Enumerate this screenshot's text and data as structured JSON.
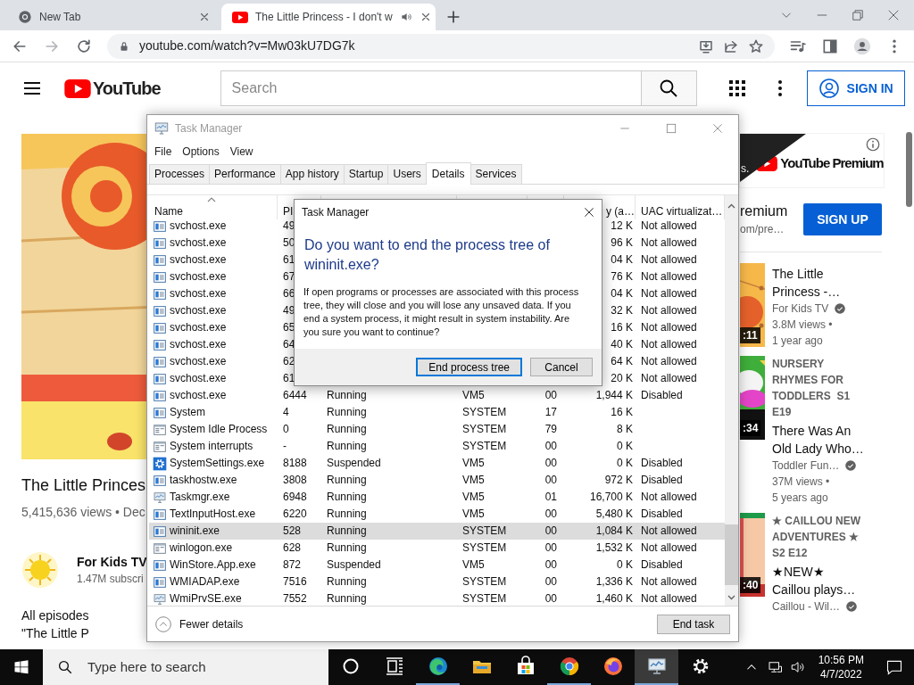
{
  "browser": {
    "tabs": [
      {
        "title": "New Tab",
        "kind": "chrome",
        "selected": false,
        "audio": false
      },
      {
        "title": "The Little Princess - I don't w",
        "kind": "youtube",
        "selected": true,
        "audio": true
      }
    ],
    "url": "youtube.com/watch?v=Mw03kU7DG7k"
  },
  "youtube": {
    "logo": "YouTube",
    "search_placeholder": "Search",
    "sign_in": "SIGN IN",
    "video": {
      "title": "The Little Princes",
      "stats": "5,415,636 views • Dec",
      "channel": "For Kids TV",
      "subscribers": "1.47M subscri",
      "description": [
        "All episodes",
        "\"The Little P"
      ]
    },
    "ad": {
      "fragment": "s.",
      "logo": "YouTube Premium",
      "line_1": "remium",
      "line_2": "om/pre…",
      "button": "SIGN UP"
    },
    "related": [
      {
        "kind": "orange",
        "title": "The Little Princess -…",
        "channel": "For Kids TV",
        "views": "3.8M views •",
        "age": "1 year ago",
        "duration": ":11"
      },
      {
        "kind": "green",
        "series": "NURSERY RHYMES FOR TODDLERS  S1 E19",
        "title": "There Was An Old Lady Who…",
        "channel": "Toddler Fun…",
        "views": "37M views •",
        "age": "5 years ago",
        "duration": ":34"
      },
      {
        "kind": "peach",
        "series": "★ CAILLOU NEW ADVENTURES ★  S2 E12",
        "title": "★NEW★ Caillou plays…",
        "channel": "Caillou - Wil…",
        "duration": ":40"
      }
    ]
  },
  "task_manager": {
    "title": "Task Manager",
    "menu": [
      "File",
      "Options",
      "View"
    ],
    "tabs": [
      {
        "label": "Processes",
        "selected": false
      },
      {
        "label": "Performance",
        "selected": false
      },
      {
        "label": "App history",
        "selected": false
      },
      {
        "label": "Startup",
        "selected": false
      },
      {
        "label": "Users",
        "selected": false
      },
      {
        "label": "Details",
        "selected": true
      },
      {
        "label": "Services",
        "selected": false
      }
    ],
    "columns": {
      "name": "Name",
      "pid": "PI",
      "memory": "y (a…",
      "uac": "UAC virtualizat…"
    },
    "rows": [
      {
        "kind": "window",
        "name": "svchost.exe",
        "pid": "49",
        "memory": "12 K",
        "uac": "Not allowed",
        "selected": false
      },
      {
        "kind": "window",
        "name": "svchost.exe",
        "pid": "50",
        "memory": "96 K",
        "uac": "Not allowed",
        "selected": false
      },
      {
        "kind": "window",
        "name": "svchost.exe",
        "pid": "61",
        "memory": "04 K",
        "uac": "Not allowed",
        "selected": false
      },
      {
        "kind": "window",
        "name": "svchost.exe",
        "pid": "67",
        "memory": "76 K",
        "uac": "Not allowed",
        "selected": false
      },
      {
        "kind": "window",
        "name": "svchost.exe",
        "pid": "66",
        "memory": "04 K",
        "uac": "Not allowed",
        "selected": false
      },
      {
        "kind": "window",
        "name": "svchost.exe",
        "pid": "49",
        "memory": "32 K",
        "uac": "Not allowed",
        "selected": false
      },
      {
        "kind": "window",
        "name": "svchost.exe",
        "pid": "65",
        "memory": "16 K",
        "uac": "Not allowed",
        "selected": false
      },
      {
        "kind": "window",
        "name": "svchost.exe",
        "pid": "64",
        "memory": "40 K",
        "uac": "Not allowed",
        "selected": false
      },
      {
        "kind": "window",
        "name": "svchost.exe",
        "pid": "62",
        "memory": "64 K",
        "uac": "Not allowed",
        "selected": false
      },
      {
        "kind": "window",
        "name": "svchost.exe",
        "pid": "61",
        "memory": "20 K",
        "uac": "Not allowed",
        "selected": false
      },
      {
        "kind": "window",
        "name": "svchost.exe",
        "pid": "6444",
        "status": "Running",
        "user": "VM5",
        "cpu": "00",
        "memory": "1,944 K",
        "uac": "Disabled",
        "selected": false
      },
      {
        "kind": "window",
        "name": "System",
        "pid": "4",
        "status": "Running",
        "user": "SYSTEM",
        "cpu": "17",
        "memory": "16 K",
        "selected": false
      },
      {
        "kind": "system",
        "name": "System Idle Process",
        "pid": "0",
        "status": "Running",
        "user": "SYSTEM",
        "cpu": "79",
        "memory": "8 K",
        "selected": false
      },
      {
        "kind": "system",
        "name": "System interrupts",
        "pid": "-",
        "status": "Running",
        "user": "SYSTEM",
        "cpu": "00",
        "memory": "0 K",
        "selected": false
      },
      {
        "kind": "settings",
        "name": "SystemSettings.exe",
        "pid": "8188",
        "status": "Suspended",
        "user": "VM5",
        "cpu": "00",
        "memory": "0 K",
        "uac": "Disabled",
        "selected": false
      },
      {
        "kind": "window",
        "name": "taskhostw.exe",
        "pid": "3808",
        "status": "Running",
        "user": "VM5",
        "cpu": "00",
        "memory": "972 K",
        "uac": "Disabled",
        "selected": false
      },
      {
        "kind": "monitor",
        "name": "Taskmgr.exe",
        "pid": "6948",
        "status": "Running",
        "user": "VM5",
        "cpu": "01",
        "memory": "16,700 K",
        "uac": "Not allowed",
        "selected": false
      },
      {
        "kind": "window",
        "name": "TextInputHost.exe",
        "pid": "6220",
        "status": "Running",
        "user": "VM5",
        "cpu": "00",
        "memory": "5,480 K",
        "uac": "Disabled",
        "selected": false
      },
      {
        "kind": "window",
        "name": "wininit.exe",
        "pid": "528",
        "status": "Running",
        "user": "SYSTEM",
        "cpu": "00",
        "memory": "1,084 K",
        "uac": "Not allowed",
        "selected": true
      },
      {
        "kind": "system",
        "name": "winlogon.exe",
        "pid": "628",
        "status": "Running",
        "user": "SYSTEM",
        "cpu": "00",
        "memory": "1,532 K",
        "uac": "Not allowed",
        "selected": false
      },
      {
        "kind": "window",
        "name": "WinStore.App.exe",
        "pid": "872",
        "status": "Suspended",
        "user": "VM5",
        "cpu": "00",
        "memory": "0 K",
        "uac": "Disabled",
        "selected": false
      },
      {
        "kind": "window",
        "name": "WMIADAP.exe",
        "pid": "7516",
        "status": "Running",
        "user": "SYSTEM",
        "cpu": "00",
        "memory": "1,336 K",
        "uac": "Not allowed",
        "selected": false
      },
      {
        "kind": "monitor",
        "name": "WmiPrvSE.exe",
        "pid": "7552",
        "status": "Running",
        "user": "SYSTEM",
        "cpu": "00",
        "memory": "1,460 K",
        "uac": "Not allowed",
        "selected": false
      }
    ],
    "fewer_details": "Fewer details",
    "end_task": "End task"
  },
  "dialog": {
    "title": "Task Manager",
    "heading": "Do you want to end the process tree of wininit.exe?",
    "message": "If open programs or processes are associated with this process tree, they will close and you will lose any unsaved data. If you end a system process, it might result in system instability. Are you sure you want to continue?",
    "buttons": [
      {
        "label": "End process tree",
        "default": true
      },
      {
        "label": "Cancel",
        "default": false
      }
    ]
  },
  "taskbar": {
    "search_placeholder": "Type here to search",
    "apps": [
      {
        "kind": "cortana",
        "running": false,
        "selected": false
      },
      {
        "kind": "taskview",
        "running": false,
        "selected": false
      },
      {
        "kind": "edge",
        "running": true,
        "selected": false
      },
      {
        "kind": "explorer",
        "running": false,
        "selected": false
      },
      {
        "kind": "store",
        "running": false,
        "selected": false
      },
      {
        "kind": "chrome",
        "running": true,
        "selected": false
      },
      {
        "kind": "firefox",
        "running": false,
        "selected": false
      },
      {
        "kind": "taskmgr",
        "running": true,
        "selected": true
      },
      {
        "kind": "settings",
        "running": false,
        "selected": false
      }
    ],
    "time": "10:56 PM",
    "date": "4/7/2022"
  }
}
